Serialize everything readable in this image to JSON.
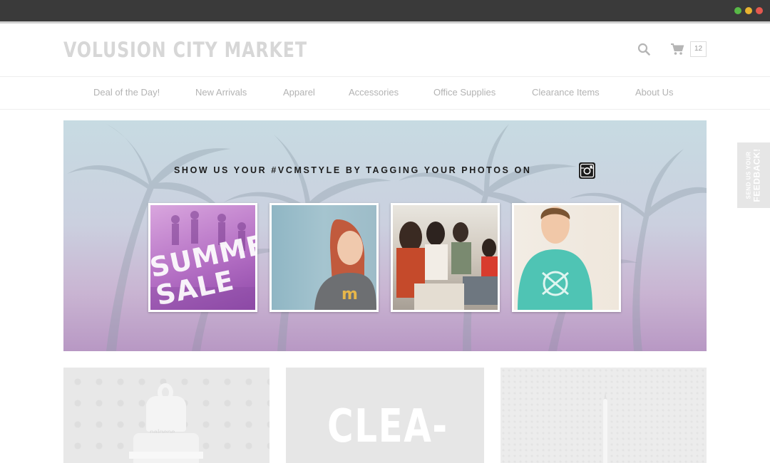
{
  "window": {
    "controls": [
      "minimize",
      "zoom",
      "close"
    ]
  },
  "header": {
    "logo_text": "VOLUSION CITY MARKET",
    "search_icon": "search-icon",
    "cart_icon": "cart-icon",
    "cart_count": "12"
  },
  "nav": {
    "items": [
      {
        "label": "Deal of the Day!"
      },
      {
        "label": "New Arrivals"
      },
      {
        "label": "Apparel"
      },
      {
        "label": "Accessories"
      },
      {
        "label": "Office Supplies"
      },
      {
        "label": "Clearance Items"
      },
      {
        "label": "About Us"
      }
    ]
  },
  "banner": {
    "heading": "SHOW US YOUR #VCMSTYLE BY TAGGING YOUR PHOTOS ON",
    "icon": "instagram-icon",
    "photos": [
      {
        "alt": "summer-sale",
        "overlay_text": "SUMMER SALE"
      },
      {
        "alt": "woman-in-tshirt"
      },
      {
        "alt": "people-at-table"
      },
      {
        "alt": "man-in-green-tshirt"
      }
    ]
  },
  "feedback": {
    "line1": "SEND US YOUR",
    "line2": "FEEDBACK!"
  },
  "tiles": [
    {
      "alt": "water-bottle",
      "brand_text": "nalgene"
    },
    {
      "alt": "clearance",
      "text": "CLEA-"
    },
    {
      "alt": "pen"
    }
  ],
  "colors": {
    "logo": "#d7d7d7",
    "nav_text": "#b3b3b3",
    "banner_top": "#c7dbe2",
    "banner_bottom": "#b898c4"
  }
}
